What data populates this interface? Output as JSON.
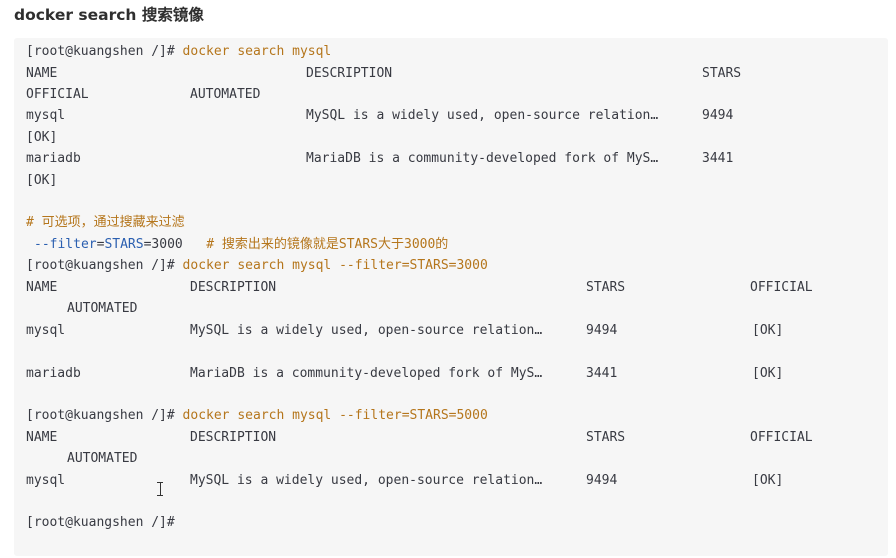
{
  "heading": "docker search 搜索镜像",
  "block1": {
    "prompt": "[root@kuangshen /]#",
    "command": "docker search mysql",
    "header_name": "NAME",
    "header_description": "DESCRIPTION",
    "header_stars": "STARS",
    "header_official": "OFFICIAL",
    "header_automated": "AUTOMATED",
    "rows": [
      {
        "name": "mysql",
        "description": "MySQL is a widely used, open-source relation…",
        "stars": "9494",
        "official": "[OK]"
      },
      {
        "name": "mariadb",
        "description": "MariaDB is a community-developed fork of MyS…",
        "stars": "3441",
        "official": "[OK]"
      }
    ]
  },
  "filter_note": {
    "comment_line": "# 可选项，通过搜藏来过滤",
    "option_flag": "--filter",
    "option_eq1": "=",
    "option_key": "STARS",
    "option_eq2": "=",
    "option_value": "3000",
    "option_comment": "# 搜索出来的镜像就是STARS大于3000的"
  },
  "block2": {
    "prompt": "[root@kuangshen /]#",
    "command": "docker search mysql --filter=STARS=3000",
    "header_name": "NAME",
    "header_description": "DESCRIPTION",
    "header_stars": "STARS",
    "header_official": "OFFICIAL",
    "header_automated": "AUTOMATED",
    "rows": [
      {
        "name": "mysql",
        "description": "MySQL is a widely used, open-source relation…",
        "stars": "9494",
        "official": "[OK]"
      },
      {
        "name": "mariadb",
        "description": "MariaDB is a community-developed fork of MyS…",
        "stars": "3441",
        "official": "[OK]"
      }
    ]
  },
  "block3": {
    "prompt": "[root@kuangshen /]#",
    "command": "docker search mysql --filter=STARS=5000",
    "header_name": "NAME",
    "header_description": "DESCRIPTION",
    "header_stars": "STARS",
    "header_official": "OFFICIAL",
    "header_automated": "AUTOMATED",
    "rows": [
      {
        "name": "mysql",
        "description": "MySQL is a widely used, open-source relation…",
        "stars": "9494",
        "official": "[OK]"
      }
    ]
  },
  "final_prompt": "[root@kuangshen /]#"
}
